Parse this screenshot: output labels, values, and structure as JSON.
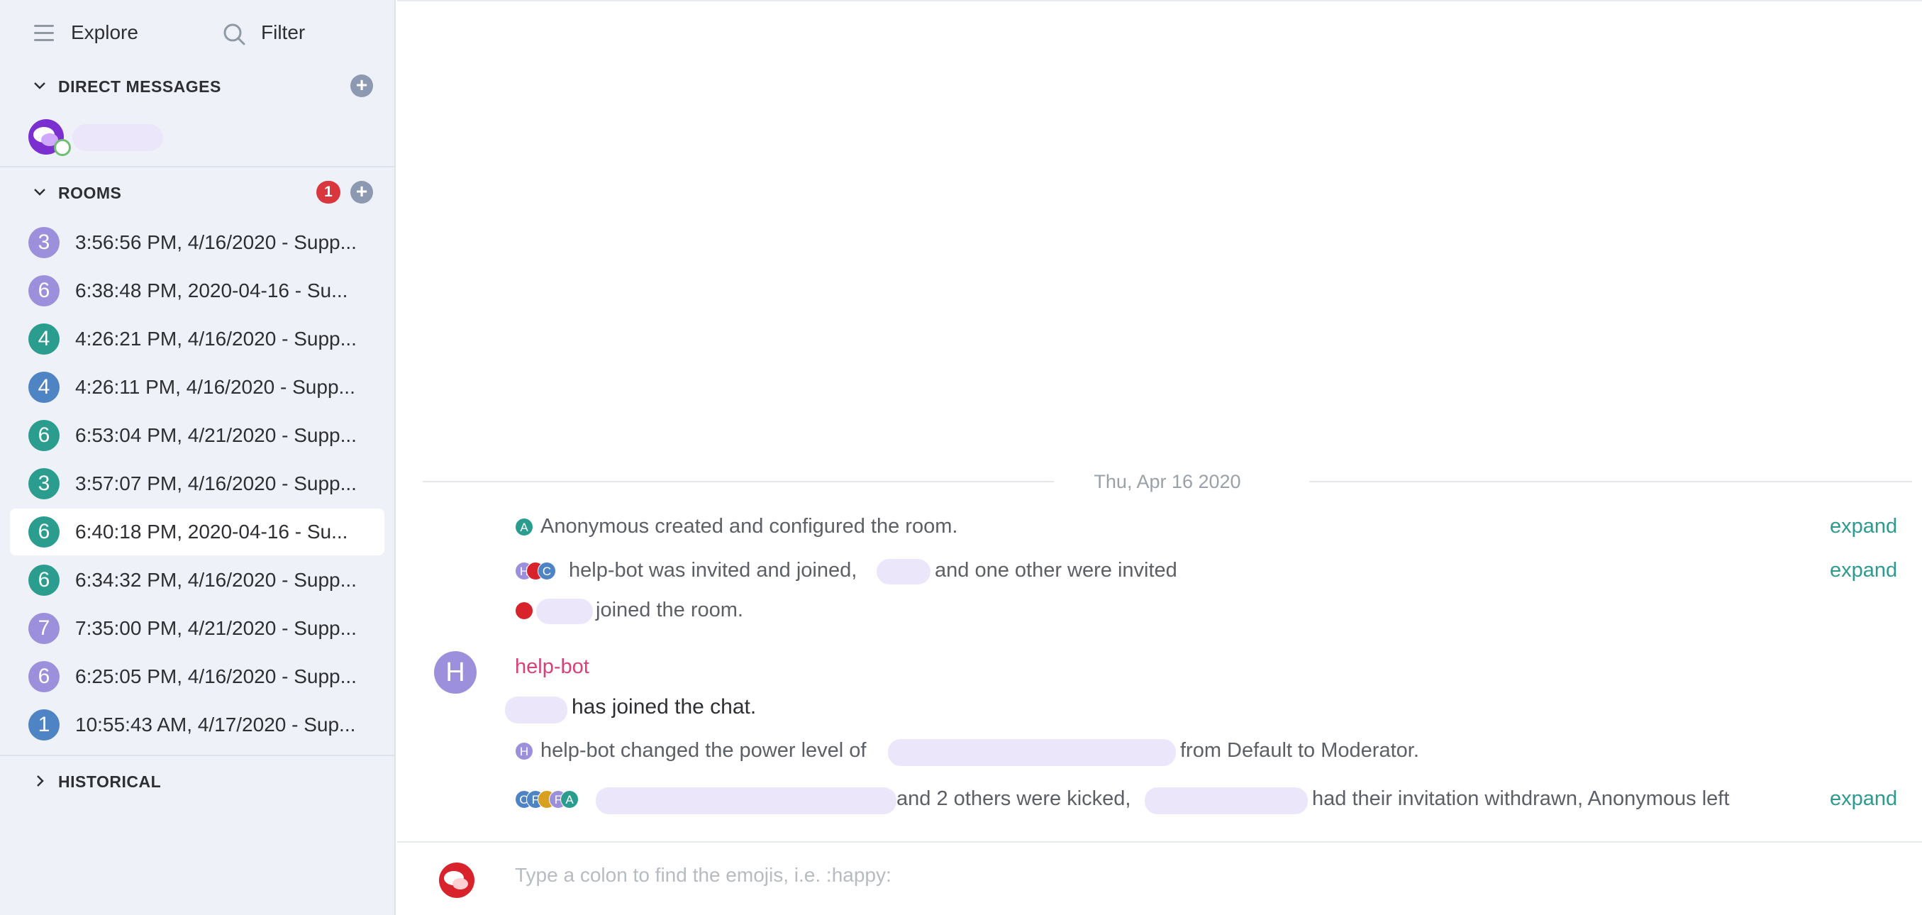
{
  "sidebar": {
    "explore_label": "Explore",
    "filter_label": "Filter",
    "direct_messages": {
      "label": "DIRECT MESSAGES",
      "add_label": "+"
    },
    "rooms": {
      "label": "ROOMS",
      "badge": "1",
      "add_label": "+",
      "items": [
        {
          "avatar": "3",
          "name": "3:56:56 PM, 4/16/2020 - Supp...",
          "color": "#9c90dc"
        },
        {
          "avatar": "6",
          "name": "6:38:48 PM, 2020-04-16 - Su...",
          "color": "#9c90dc"
        },
        {
          "avatar": "4",
          "name": "4:26:21 PM, 4/16/2020 - Supp...",
          "color": "#2a9d8f"
        },
        {
          "avatar": "4",
          "name": "4:26:11 PM, 4/16/2020 - Supp...",
          "color": "#4f84c4"
        },
        {
          "avatar": "6",
          "name": "6:53:04 PM, 4/21/2020 - Supp...",
          "color": "#2a9d8f"
        },
        {
          "avatar": "3",
          "name": "3:57:07 PM, 4/16/2020 - Supp...",
          "color": "#2a9d8f"
        },
        {
          "avatar": "6",
          "name": "6:40:18 PM, 2020-04-16 - Su...",
          "color": "#2a9d8f"
        },
        {
          "avatar": "6",
          "name": "6:34:32 PM, 4/16/2020 - Supp...",
          "color": "#2a9d8f"
        },
        {
          "avatar": "7",
          "name": "7:35:00 PM, 4/21/2020 - Supp...",
          "color": "#9c90dc"
        },
        {
          "avatar": "6",
          "name": "6:25:05 PM, 4/16/2020 - Supp...",
          "color": "#9c90dc"
        },
        {
          "avatar": "1",
          "name": "10:55:43 AM, 4/17/2020 - Sup...",
          "color": "#4f84c4"
        }
      ]
    },
    "historical": {
      "label": "HISTORICAL"
    }
  },
  "timeline": {
    "date_separator": "Thu, Apr 16 2020",
    "event1": {
      "avatar": "A",
      "text": "Anonymous created and configured the room.",
      "expand": "expand"
    },
    "event2": {
      "avatars": [
        "H",
        "C"
      ],
      "text_a": "help-bot was invited and joined,",
      "text_b": "and one other were invited",
      "expand": "expand"
    },
    "event3": {
      "text": "joined the room."
    },
    "message": {
      "avatar": "H",
      "sender": "help-bot",
      "line1": "has joined the chat.",
      "power_avatar": "H",
      "power_text_a": "help-bot changed the power level of",
      "power_text_b": "from Default to Moderator."
    },
    "event4": {
      "avatars": [
        "O",
        "F",
        "F",
        "A"
      ],
      "text_a": "and 2 others were kicked,",
      "text_b": "had their invitation withdrawn, Anonymous left",
      "expand": "expand"
    }
  },
  "composer": {
    "placeholder": "Type a colon to find the emojis, i.e. :happy:"
  },
  "colors": {
    "accent": "#2e9a8e",
    "sender": "#d8407a",
    "badge": "#d9363e",
    "brand_red": "#d9232c",
    "dm_purple": "#7b2fd0"
  }
}
